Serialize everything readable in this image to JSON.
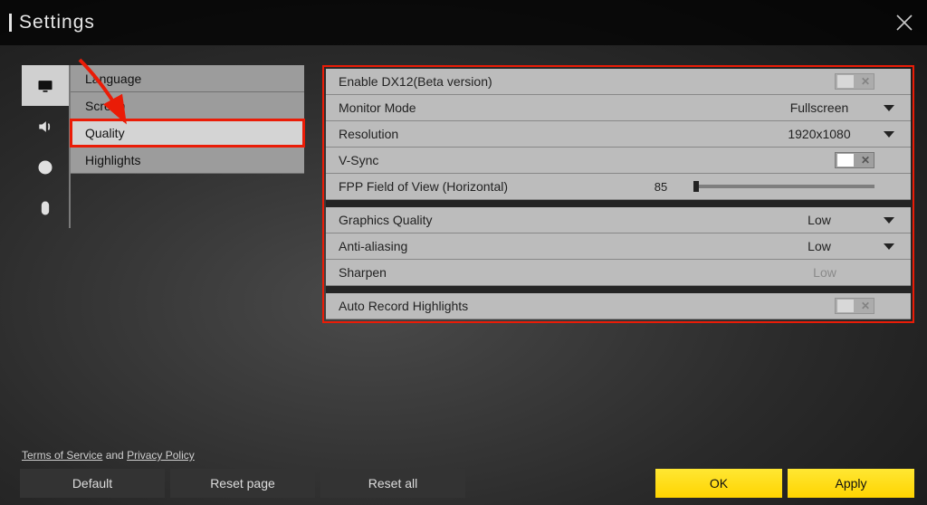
{
  "header": {
    "title": "Settings"
  },
  "sidebar_tabs": [
    "display",
    "audio",
    "accessibility",
    "mouse"
  ],
  "submenu": {
    "items": [
      {
        "label": "Language"
      },
      {
        "label": "Screen"
      },
      {
        "label": "Quality",
        "selected": true
      },
      {
        "label": "Highlights"
      }
    ]
  },
  "settings": {
    "rows": [
      {
        "label": "Enable DX12(Beta version)",
        "type": "toggle",
        "value": "off",
        "disabled": true
      },
      {
        "label": "Monitor Mode",
        "type": "dropdown",
        "value": "Fullscreen"
      },
      {
        "label": "Resolution",
        "type": "dropdown",
        "value": "1920x1080"
      },
      {
        "label": "V-Sync",
        "type": "toggle",
        "value": "off"
      },
      {
        "label": "FPP Field of View (Horizontal)",
        "type": "slider",
        "value": "85"
      }
    ],
    "rows2": [
      {
        "label": "Graphics Quality",
        "type": "dropdown",
        "value": "Low"
      },
      {
        "label": "Anti-aliasing",
        "type": "dropdown",
        "value": "Low"
      },
      {
        "label": "Sharpen",
        "type": "static",
        "value": "Low"
      }
    ],
    "rows3": [
      {
        "label": "Auto Record Highlights",
        "type": "toggle",
        "value": "off",
        "disabled": true
      }
    ]
  },
  "footer": {
    "tos": "Terms of Service",
    "and": " and ",
    "privacy": "Privacy Policy",
    "buttons": {
      "default": "Default",
      "reset_page": "Reset page",
      "reset_all": "Reset all",
      "ok": "OK",
      "apply": "Apply"
    }
  }
}
